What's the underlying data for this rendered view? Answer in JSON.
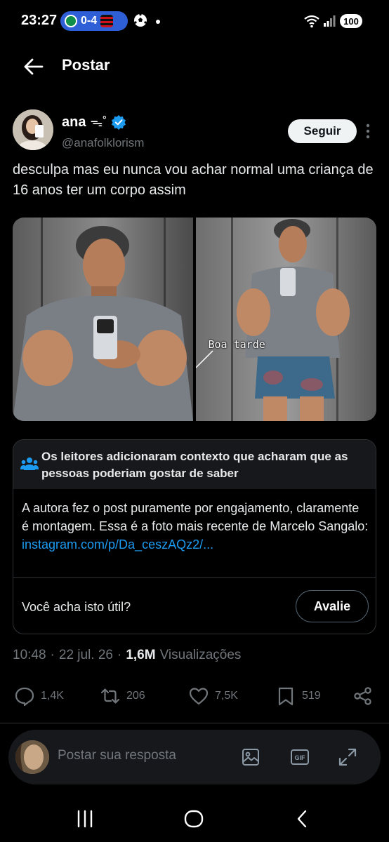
{
  "status_bar": {
    "time": "23:27",
    "score": "0-4",
    "battery": "100"
  },
  "header": {
    "title": "Postar"
  },
  "author": {
    "name": "ana",
    "emoji": "ᯓ˚",
    "handle": "@anafolklorism",
    "follow_label": "Seguir"
  },
  "tweet": {
    "text": "desculpa mas eu nunca vou achar normal uma criança de 16 anos ter um corpo assim",
    "image_caption": "Boa tarde"
  },
  "community_note": {
    "title": "Os leitores adicionaram contexto que acharam que as pessoas poderiam gostar de saber",
    "body": "A autora fez o post puramente por engajamento, claramente é montagem. Essa é a foto mais recente de Marcelo Sangalo: ",
    "link": "instagram.com/p/Da_ceszAQz2/...",
    "question": "Você acha isto útil?",
    "rate_label": "Avalie"
  },
  "meta": {
    "time": "10:48",
    "date": "22 jul. 26",
    "views_count": "1,6M",
    "views_label": "Visualizações"
  },
  "actions": {
    "replies": "1,4K",
    "reposts": "206",
    "likes": "7,5K",
    "bookmarks": "519"
  },
  "reply": {
    "placeholder": "Postar sua resposta"
  },
  "colors": {
    "background": "#000000",
    "accent": "#1d9bf0",
    "muted": "#71767b"
  },
  "icons": [
    "back-arrow",
    "verified-badge",
    "more-vertical",
    "people",
    "reply",
    "repost",
    "like",
    "bookmark",
    "share",
    "image",
    "gif",
    "expand",
    "recents",
    "home",
    "back"
  ]
}
